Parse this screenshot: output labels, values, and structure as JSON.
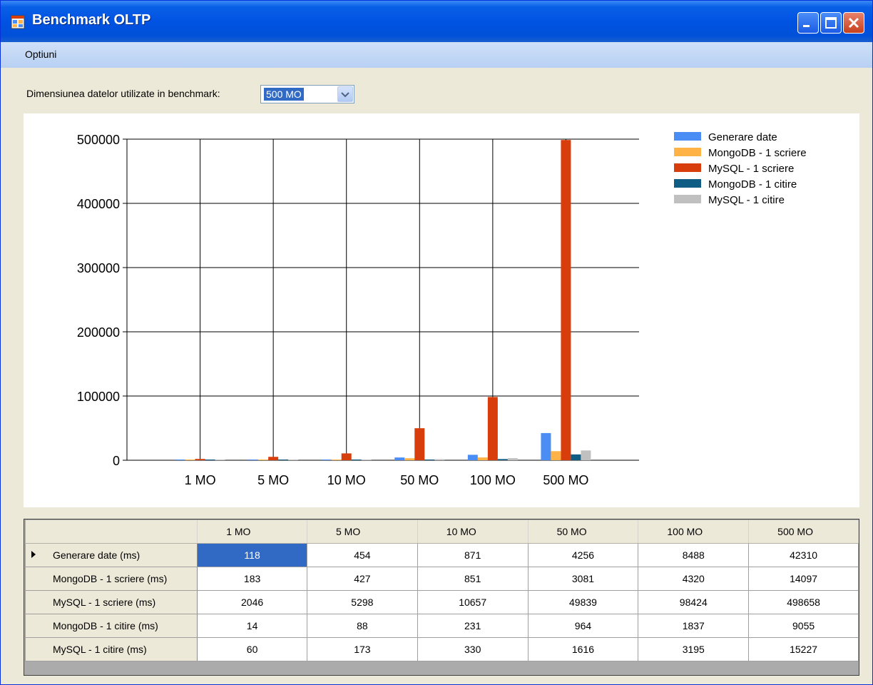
{
  "window": {
    "title": "Benchmark OLTP",
    "icon": "app-window-icon"
  },
  "menu": {
    "items": [
      "Optiuni"
    ]
  },
  "controls": {
    "dimension_label": "Dimensiunea datelor utilizate in benchmark:",
    "dimension_value": "500 MO"
  },
  "colors": {
    "title_bar": "#0053e2",
    "selection": "#316ac5",
    "series": [
      "#4a8ef5",
      "#ffb347",
      "#d83e0c",
      "#0f5c85",
      "#c0c0c0"
    ]
  },
  "chart_data": {
    "type": "bar",
    "title": "",
    "xlabel": "",
    "ylabel": "",
    "categories": [
      "1 MO",
      "5 MO",
      "10 MO",
      "50 MO",
      "100 MO",
      "500 MO"
    ],
    "ylim": [
      0,
      500000
    ],
    "yticks": [
      0,
      100000,
      200000,
      300000,
      400000,
      500000
    ],
    "grid": true,
    "legend_position": "top-right",
    "series": [
      {
        "name": "Generare date",
        "values": [
          118,
          454,
          871,
          4256,
          8488,
          42310
        ]
      },
      {
        "name": "MongoDB - 1 scriere",
        "values": [
          183,
          427,
          851,
          3081,
          4320,
          14097
        ]
      },
      {
        "name": "MySQL - 1 scriere",
        "values": [
          2046,
          5298,
          10657,
          49839,
          98424,
          498658
        ]
      },
      {
        "name": "MongoDB - 1 citire",
        "values": [
          14,
          88,
          231,
          964,
          1837,
          9055
        ]
      },
      {
        "name": "MySQL - 1 citire",
        "values": [
          60,
          173,
          330,
          1616,
          3195,
          15227
        ]
      }
    ]
  },
  "table": {
    "columns": [
      "1 MO",
      "5 MO",
      "10 MO",
      "50 MO",
      "100 MO",
      "500 MO"
    ],
    "rows": [
      {
        "label": "Generare date (ms)",
        "cells": [
          "118",
          "454",
          "871",
          "4256",
          "8488",
          "42310"
        ]
      },
      {
        "label": "MongoDB - 1 scriere (ms)",
        "cells": [
          "183",
          "427",
          "851",
          "3081",
          "4320",
          "14097"
        ]
      },
      {
        "label": "MySQL - 1 scriere (ms)",
        "cells": [
          "2046",
          "5298",
          "10657",
          "49839",
          "98424",
          "498658"
        ]
      },
      {
        "label": "MongoDB - 1 citire (ms)",
        "cells": [
          "14",
          "88",
          "231",
          "964",
          "1837",
          "9055"
        ]
      },
      {
        "label": "MySQL - 1 citire (ms)",
        "cells": [
          "60",
          "173",
          "330",
          "1616",
          "3195",
          "15227"
        ]
      }
    ]
  }
}
